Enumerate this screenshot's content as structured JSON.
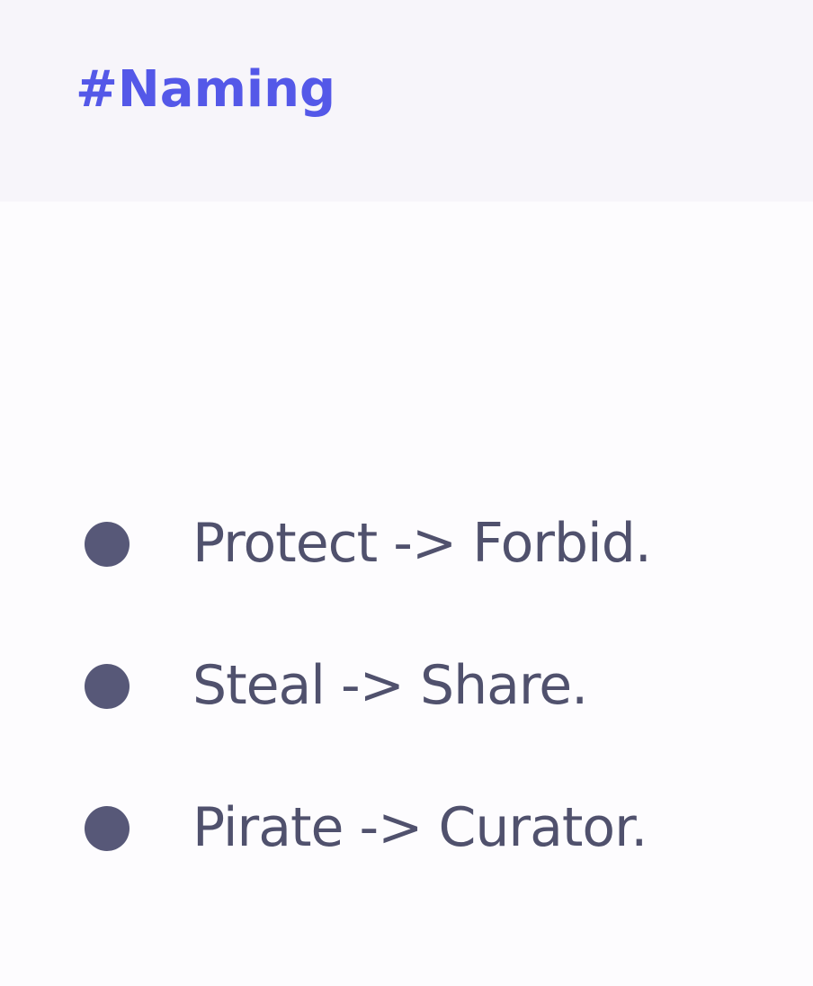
{
  "header": {
    "title": "#Naming"
  },
  "list": {
    "items": [
      {
        "text": "Protect -> Forbid."
      },
      {
        "text": "Steal -> Share."
      },
      {
        "text": "Pirate -> Curator."
      }
    ]
  },
  "colors": {
    "header_background": "#f7f5fa",
    "page_background": "#fdfcfe",
    "title": "#5458e8",
    "body_text": "#50516d",
    "bullet": "#575878"
  }
}
